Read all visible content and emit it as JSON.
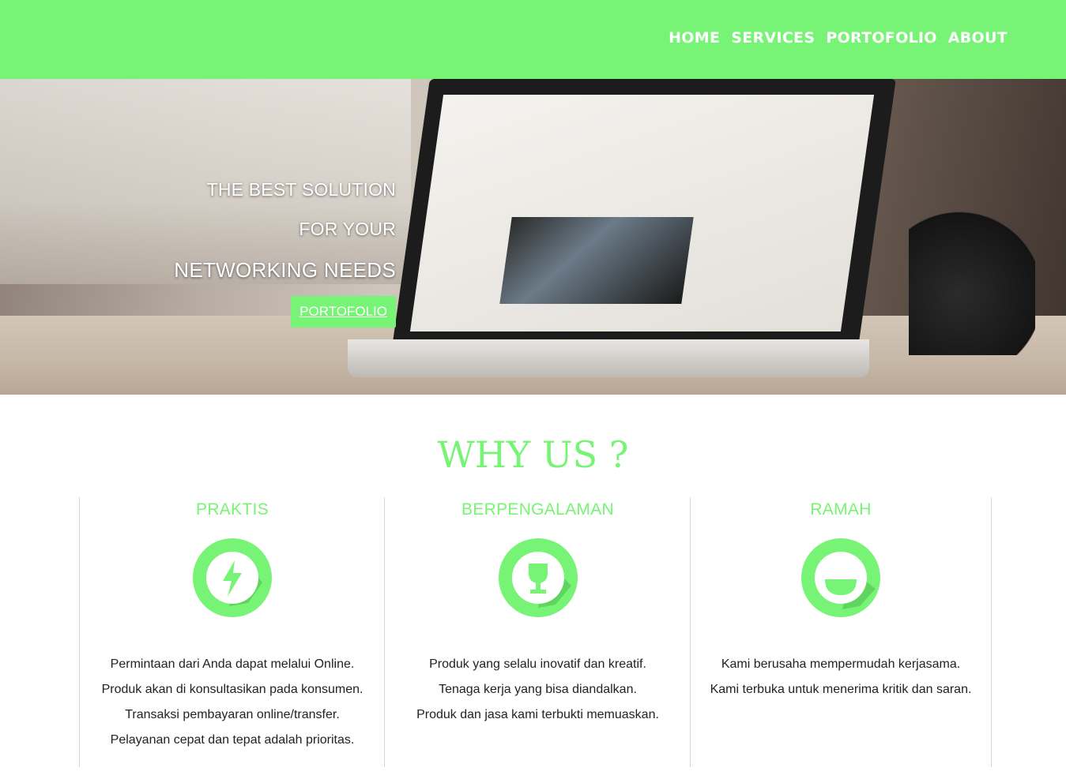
{
  "nav": {
    "items": [
      {
        "label": "HOME"
      },
      {
        "label": "SERVICES"
      },
      {
        "label": "PORTOFOLIO"
      },
      {
        "label": "ABOUT"
      }
    ]
  },
  "hero": {
    "line1": "THE BEST SOLUTION",
    "line2": "FOR YOUR",
    "line3": "NETWORKING NEEDS",
    "button_label": "PORTOFOLIO"
  },
  "why": {
    "title": "WHY US ?",
    "columns": [
      {
        "title": "PRAKTIS",
        "icon": "lightning-icon",
        "lines": [
          "Permintaan dari Anda dapat melalui Online.",
          "Produk akan di konsultasikan pada konsumen.",
          "Transaksi pembayaran online/transfer.",
          "Pelayanan cepat dan tepat adalah prioritas."
        ]
      },
      {
        "title": "BERPENGALAMAN",
        "icon": "trophy-icon",
        "lines": [
          "Produk yang selalu inovatif dan kreatif.",
          "Tenaga kerja yang bisa diandalkan.",
          "Produk dan jasa kami terbukti memuaskan."
        ]
      },
      {
        "title": "RAMAH",
        "icon": "smile-icon",
        "lines": [
          "Kami berusaha mempermudah kerjasama.",
          "Kami terbuka untuk menerima kritik dan saran."
        ]
      }
    ]
  },
  "colors": {
    "accent": "#77f475",
    "accent_dark": "#5fd45e",
    "text": "#222222",
    "divider": "#d6d6d6"
  }
}
